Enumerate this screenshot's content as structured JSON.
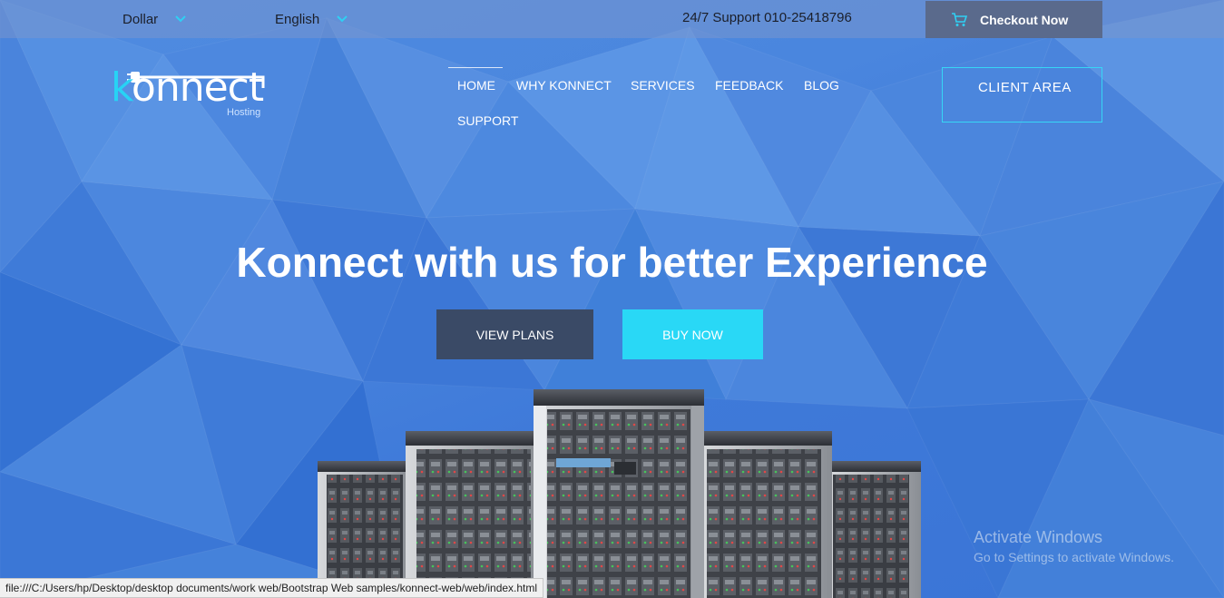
{
  "topbar": {
    "currency": "Dollar",
    "language": "English",
    "support": "24/7 Support 010-25418796",
    "checkout_label": "Checkout Now"
  },
  "logo": {
    "letter_k": "k",
    "rest": "onnect",
    "sub": "Hosting"
  },
  "nav": {
    "items": [
      {
        "label": "HOME",
        "active": true
      },
      {
        "label": "WHY KONNECT"
      },
      {
        "label": "SERVICES"
      },
      {
        "label": "FEEDBACK"
      },
      {
        "label": "BLOG"
      },
      {
        "label": "SUPPORT"
      }
    ],
    "client_area": "CLIENT AREA"
  },
  "hero": {
    "title": "Konnect with us for better Experience",
    "view_plans": "VIEW PLANS",
    "buy_now": "BUY NOW"
  },
  "watermark": {
    "line1": "Activate Windows",
    "line2": "Go to Settings to activate Windows."
  },
  "statusbar": {
    "url": "file:///C:/Users/hp/Desktop/desktop documents/work web/Bootstrap Web samples/konnect-web/web/index.html"
  },
  "colors": {
    "accent": "#29d8f6",
    "dark_button": "#3a4a66",
    "checkout_bg": "#5a6a8c"
  },
  "icons": {
    "currency_toggle": "chevron-down-icon",
    "language_toggle": "chevron-down-icon",
    "checkout": "cart-icon",
    "logo": "plug-icon"
  }
}
